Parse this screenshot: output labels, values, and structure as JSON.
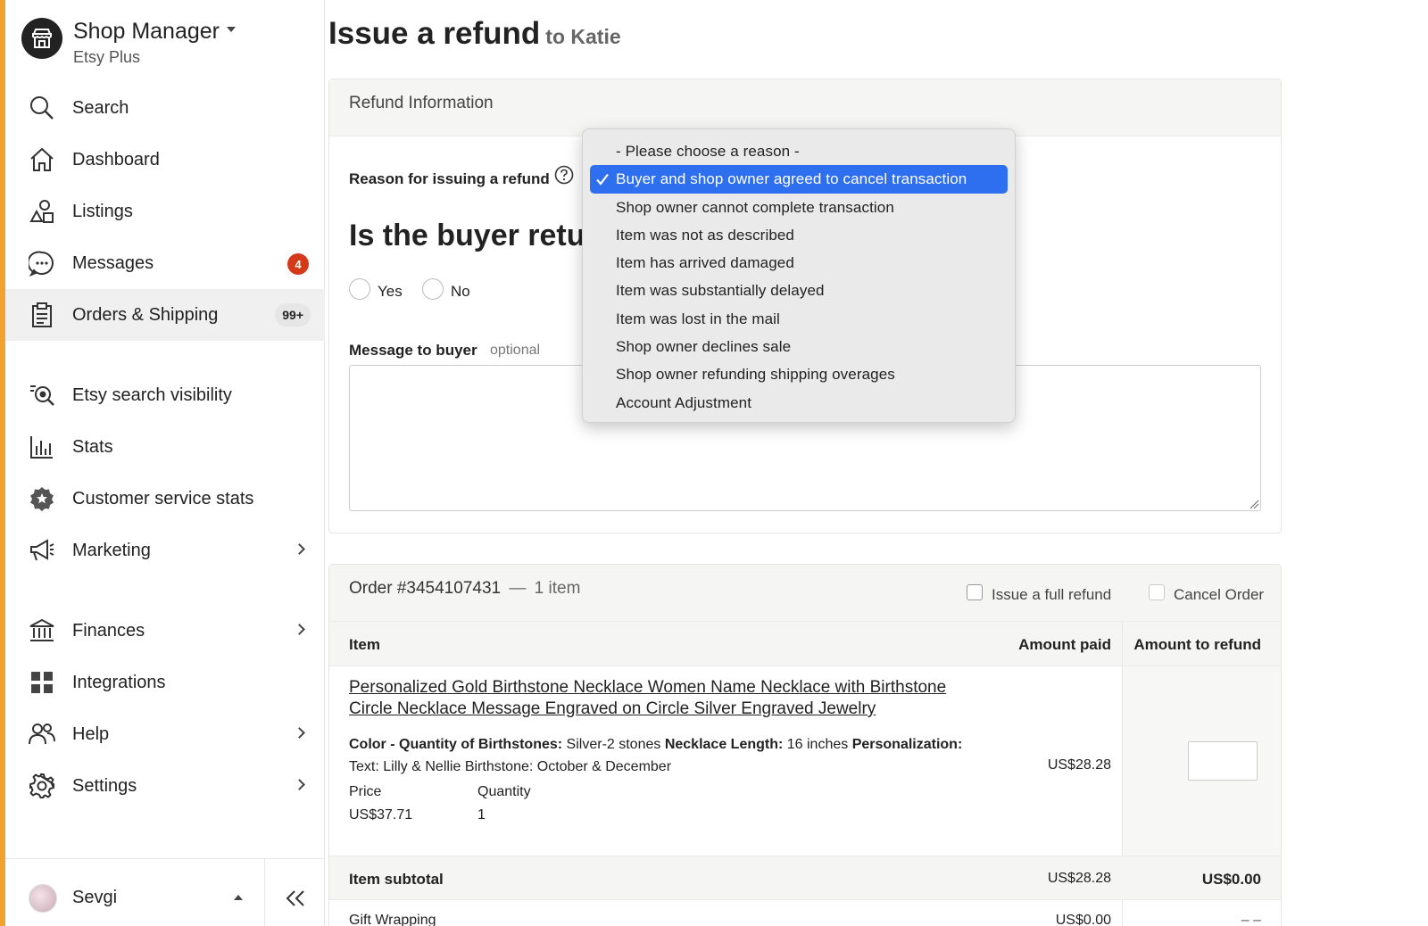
{
  "sidebar": {
    "shop_name": "Shop Manager",
    "shop_plan": "Etsy Plus",
    "items": [
      {
        "label": "Search"
      },
      {
        "label": "Dashboard"
      },
      {
        "label": "Listings"
      },
      {
        "label": "Messages",
        "badge": "4"
      },
      {
        "label": "Orders & Shipping",
        "badge": "99+"
      },
      {
        "label": "Etsy search visibility"
      },
      {
        "label": "Stats"
      },
      {
        "label": "Customer service stats"
      },
      {
        "label": "Marketing"
      },
      {
        "label": "Finances"
      },
      {
        "label": "Integrations"
      },
      {
        "label": "Help"
      },
      {
        "label": "Settings"
      }
    ],
    "user_name": "Sevgi",
    "accent_color": "#f1a12e",
    "badge_color": "#d43a1a"
  },
  "page": {
    "title": "Issue a refund",
    "subtitle": "to Katie"
  },
  "refund_info": {
    "heading": "Refund Information",
    "reason_label": "Reason for issuing a refund",
    "question": "Is the buyer retu",
    "yes_label": "Yes",
    "no_label": "No",
    "message_label": "Message to buyer",
    "message_optional": "optional",
    "message_value": ""
  },
  "reason_dropdown": {
    "selected_index": 1,
    "selected_color": "#2e6ff0",
    "options": [
      "- Please choose a reason -",
      "Buyer and shop owner agreed to cancel transaction",
      "Shop owner cannot complete transaction",
      "Item was not as described",
      "Item has arrived damaged",
      "Item was substantially delayed",
      "Item was lost in the mail",
      "Shop owner declines sale",
      "Shop owner refunding shipping overages",
      "Account Adjustment"
    ]
  },
  "order": {
    "number": "Order #3454107431",
    "dash": "—",
    "count": "1 item",
    "full_refund_label": "Issue a full refund",
    "cancel_label": "Cancel Order",
    "columns": {
      "item": "Item",
      "amount_paid": "Amount paid",
      "amount_refund": "Amount to refund"
    },
    "item": {
      "title": "Personalized Gold Birthstone Necklace Women Name Necklace with Birthstone Circle Necklace Message Engraved on Circle Silver Engraved Jewelry",
      "opt1_key": "Color - Quantity of Birthstones:",
      "opt1_val": " Silver-2 stones ",
      "opt2_key": "Necklace Length:",
      "opt2_val": " 16 inches ",
      "opt3_key": "Personalization:",
      "opt3_val": "Text: Lilly & Nellie Birthstone: October & December",
      "price_label": "Price",
      "price": "US$37.71",
      "qty_label": "Quantity",
      "qty": "1",
      "amount_paid": "US$28.28",
      "refund_value": ""
    },
    "subtotal_label": "Item subtotal",
    "subtotal_paid": "US$28.28",
    "subtotal_refund": "US$0.00",
    "gift_label": "Gift Wrapping",
    "gift_paid": "US$0.00",
    "gift_refund": "– –"
  }
}
